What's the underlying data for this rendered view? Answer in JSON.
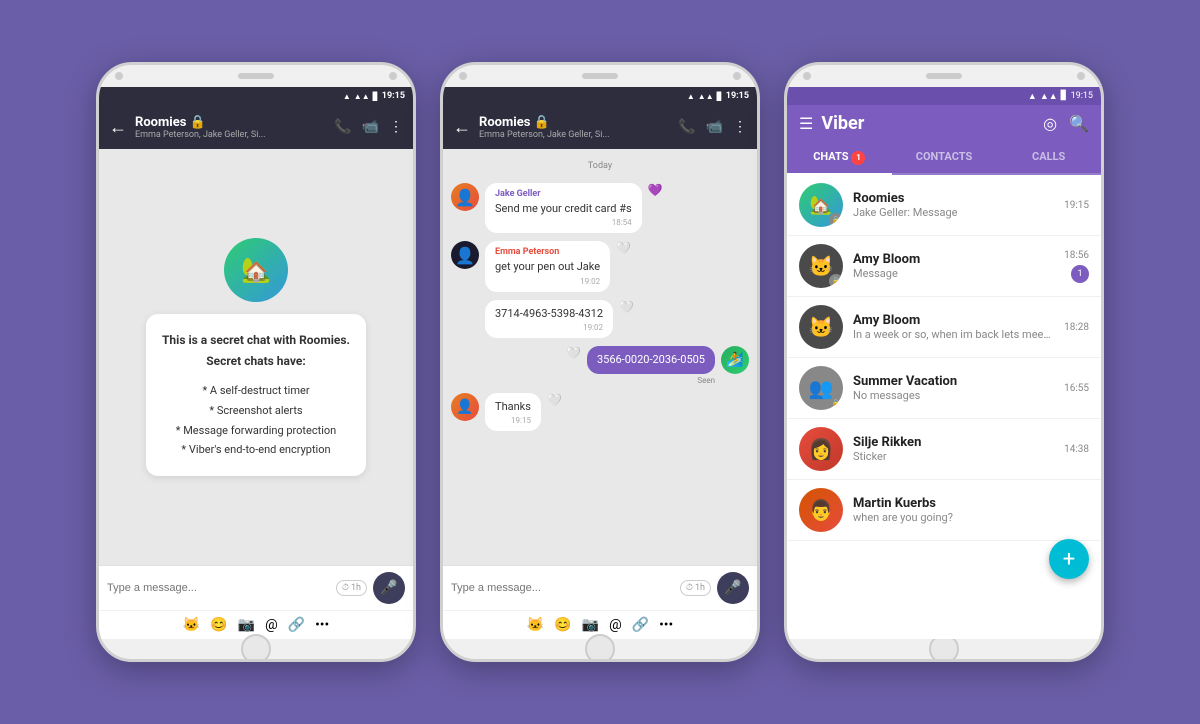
{
  "bg": "#6b5ea8",
  "phones": {
    "phone1": {
      "status_time": "19:15",
      "header": {
        "back": "←",
        "title": "Roomies 🔒",
        "subtitle": "Emma Peterson, Jake Geller, Si...",
        "actions": [
          "📞",
          "📹",
          "⋮"
        ]
      },
      "secret_chat": {
        "avatar_emoji": "🏡",
        "card_title": "This is a secret chat with Roomies.\nSecret chats have:",
        "features": [
          "* A self-destruct timer",
          "* Screenshot alerts",
          "* Message forwarding protection",
          "* Viber's end-to-end encryption"
        ]
      },
      "input_placeholder": "Type a message...",
      "timer_label": "⏱1h",
      "emoji_bar": [
        "🐱",
        "😊",
        "📷",
        "@",
        "🔗",
        "..."
      ]
    },
    "phone2": {
      "status_time": "19:15",
      "header": {
        "back": "←",
        "title": "Roomies 🔒",
        "subtitle": "Emma Peterson, Jake Geller, Si...",
        "actions": [
          "📞",
          "📹",
          "⋮"
        ]
      },
      "date_divider": "Today",
      "messages": [
        {
          "id": "m1",
          "sender": "Jake Geller",
          "text": "Send me your credit card #s",
          "time": "18:54",
          "side": "left",
          "avatar": "jake",
          "heart": true
        },
        {
          "id": "m2",
          "sender": "Emma Peterson",
          "text": "get your pen out Jake",
          "time": "19:02",
          "side": "left",
          "avatar": "emma"
        },
        {
          "id": "m3",
          "sender": "",
          "text": "3714-4963-5398-4312",
          "time": "19:02",
          "side": "left",
          "avatar": null
        },
        {
          "id": "m4",
          "sender": "",
          "text": "3566-0020-2036-0505",
          "time": "",
          "side": "right",
          "seen": "Seen",
          "avatar": "self"
        },
        {
          "id": "m5",
          "sender": "Jake Geller",
          "text": "Thanks",
          "time": "19:15",
          "side": "left",
          "avatar": "jake"
        }
      ],
      "input_placeholder": "Type a message...",
      "timer_label": "⏱1h",
      "emoji_bar": [
        "🐱",
        "😊",
        "📷",
        "@",
        "🔗",
        "..."
      ]
    },
    "phone3": {
      "status_time": "19:15",
      "app_name": "Viber",
      "header_icons": [
        "◎",
        "🔍"
      ],
      "tabs": [
        {
          "label": "CHATS",
          "badge": "1",
          "active": true
        },
        {
          "label": "CONTACTS",
          "active": false
        },
        {
          "label": "CALLS",
          "active": false
        }
      ],
      "chats": [
        {
          "id": "c1",
          "name": "Roomies",
          "preview": "Jake Geller: Message",
          "time": "19:15",
          "avatar": "roomies",
          "lock": true
        },
        {
          "id": "c2",
          "name": "Amy Bloom",
          "preview": "Message",
          "time": "18:56",
          "avatar": "amy1",
          "unread": "1",
          "lock": true
        },
        {
          "id": "c3",
          "name": "Amy Bloom",
          "preview": "In a week or so, when im back lets meet ;)",
          "time": "18:28",
          "avatar": "amy2",
          "lock": false
        },
        {
          "id": "c4",
          "name": "Summer Vacation",
          "preview": "No messages",
          "time": "16:55",
          "avatar": "summer",
          "lock": true
        },
        {
          "id": "c5",
          "name": "Silje Rikken",
          "preview": "Sticker",
          "time": "14:38",
          "avatar": "silje",
          "lock": false
        },
        {
          "id": "c6",
          "name": "Martin Kuerbs",
          "preview": "when are you going?",
          "time": "",
          "avatar": "martin",
          "lock": false
        }
      ],
      "fab_label": "+"
    }
  }
}
